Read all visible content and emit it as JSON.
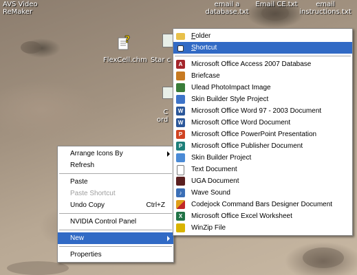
{
  "desktop": {
    "icons": [
      {
        "label": "AVS Video\nReMaker"
      },
      {
        "label": "email a\ndatabase.txt"
      },
      {
        "label": "Email CE.txt"
      },
      {
        "label": "email\ninstructions.txt"
      },
      {
        "label": "FlexCell.chm"
      },
      {
        "label": "Star c"
      },
      {
        "label": "C\nord"
      }
    ]
  },
  "context_menu": {
    "items": [
      {
        "label": "Arrange Icons By",
        "submenu": true
      },
      {
        "label": "Refresh"
      },
      {
        "label": "Paste"
      },
      {
        "label": "Paste Shortcut",
        "disabled": true
      },
      {
        "label": "Undo Copy",
        "shortcut": "Ctrl+Z"
      },
      {
        "label": "NVIDIA Control Panel"
      },
      {
        "label": "New",
        "submenu": true,
        "highlighted": true
      },
      {
        "label": "Properties"
      }
    ]
  },
  "new_submenu": {
    "items": [
      {
        "label": "Folder",
        "icon": "folder-icon",
        "color": "#e8c04a"
      },
      {
        "label": "Shortcut",
        "icon": "shortcut-icon",
        "color": "#ffffff",
        "highlighted": true
      },
      {
        "label": "Microsoft Office Access 2007 Database",
        "icon": "access-icon",
        "color": "#a4262c"
      },
      {
        "label": "Briefcase",
        "icon": "briefcase-icon",
        "color": "#c77a22"
      },
      {
        "label": "Ulead PhotoImpact Image",
        "icon": "photoimpact-icon",
        "color": "#3a7d3a"
      },
      {
        "label": "Skin Builder Style Project",
        "icon": "skin-style-icon",
        "color": "#3d74c9"
      },
      {
        "label": "Microsoft Office Word 97 - 2003 Document",
        "icon": "word-icon",
        "color": "#2b579a"
      },
      {
        "label": "Microsoft Office Word Document",
        "icon": "word-icon",
        "color": "#2b579a"
      },
      {
        "label": "Microsoft Office PowerPoint Presentation",
        "icon": "powerpoint-icon",
        "color": "#d04423"
      },
      {
        "label": "Microsoft Office Publisher Document",
        "icon": "publisher-icon",
        "color": "#1e7f7a"
      },
      {
        "label": "Skin Builder Project",
        "icon": "skin-project-icon",
        "color": "#4b8bd6"
      },
      {
        "label": "Text Document",
        "icon": "text-doc-icon",
        "color": "#9a9a9a"
      },
      {
        "label": "UGA Document",
        "icon": "uga-icon",
        "color": "#5a1f1f"
      },
      {
        "label": "Wave Sound",
        "icon": "wave-icon",
        "color": "#3b6fb6"
      },
      {
        "label": "Codejock Command Bars Designer Document",
        "icon": "codejock-icon",
        "color": "#e0a01a"
      },
      {
        "label": "Microsoft Office Excel Worksheet",
        "icon": "excel-icon",
        "color": "#217346"
      },
      {
        "label": "WinZip File",
        "icon": "winzip-icon",
        "color": "#d9b400"
      }
    ]
  }
}
